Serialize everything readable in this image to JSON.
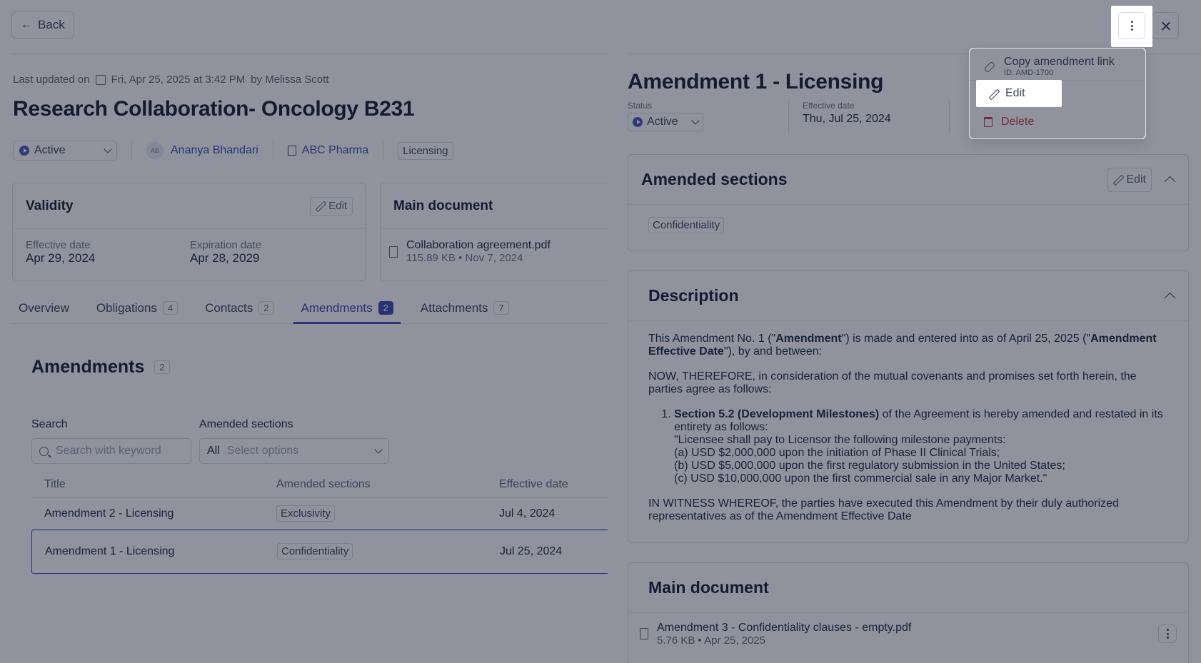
{
  "page": {
    "back_label": "Back",
    "updated_prefix": "Last updated on",
    "updated_date": "Fri, Apr 25, 2025 at 3:42 PM",
    "updated_by": "by Melissa Scott",
    "title": "Research Collaboration- Oncology B231",
    "status": "Active",
    "owner_initials": "AB",
    "owner_name": "Ananya Bhandari",
    "company": "ABC Pharma",
    "category_tag": "Licensing",
    "validity": {
      "title": "Validity",
      "edit_label": "Edit",
      "effective_label": "Effective date",
      "effective_value": "Apr 29, 2024",
      "expiration_label": "Expiration date",
      "expiration_value": "Apr 28, 2029"
    },
    "main_document": {
      "title": "Main document",
      "file_name": "Collaboration agreement.pdf",
      "file_meta": "115.89 KB • Nov 7, 2024"
    },
    "tabs": [
      {
        "label": "Overview",
        "count": ""
      },
      {
        "label": "Obligations",
        "count": "4"
      },
      {
        "label": "Contacts",
        "count": "2"
      },
      {
        "label": "Amendments",
        "count": "2"
      },
      {
        "label": "Attachments",
        "count": "7"
      }
    ],
    "amendments": {
      "title": "Amendments",
      "count": "2",
      "search_label": "Search",
      "search_placeholder": "Search with keyword",
      "sections_label": "Amended sections",
      "sections_all": "All",
      "sections_placeholder": "Select options",
      "columns": [
        "Title",
        "Amended sections",
        "Effective date"
      ],
      "rows": [
        {
          "title": "Amendment 2 - Licensing",
          "section": "Exclusivity",
          "date": "Jul 4, 2024"
        },
        {
          "title": "Amendment 1 - Licensing",
          "section": "Confidentiality",
          "date": "Jul 25, 2024"
        }
      ]
    }
  },
  "drawer": {
    "title": "Amendment 1 - Licensing",
    "status_label": "Status",
    "status_value": "Active",
    "effective_label": "Effective date",
    "effective_value": "Thu, Jul 25, 2024",
    "amended_sections": {
      "title": "Amended sections",
      "edit_label": "Edit",
      "tag": "Confidentiality"
    },
    "description": {
      "title": "Description",
      "p1_a": "This Amendment No. 1 (\"",
      "p1_b": "Amendment",
      "p1_c": "\") is made and entered into as of April 25, 2025 (\"",
      "p1_d": "Amendment Effective Date",
      "p1_e": "\"), by and between:",
      "p2": "NOW, THEREFORE, in consideration of the mutual covenants and promises set forth herein, the parties agree as follows:",
      "li_bold": "Section 5.2 (Development Milestones)",
      "li_rest": " of the Agreement is hereby amended and restated in its entirety as follows:",
      "li_l1": "\"Licensee shall pay to Licensor the following milestone payments:",
      "li_l2": "(a) USD $2,000,000 upon the initiation of Phase II Clinical Trials;",
      "li_l3": "(b) USD $5,000,000 upon the first regulatory submission in the United States;",
      "li_l4": "(c) USD $10,000,000 upon the first commercial sale in any Major Market.\"",
      "p3": "IN WITNESS WHEREOF, the parties have executed this Amendment by their duly authorized representatives as of the Amendment Effective Date"
    },
    "main_document": {
      "title": "Main document",
      "file_name": "Amendment 3 - Confidentiality clauses - empty.pdf",
      "file_meta": "5.76 KB • Apr 25, 2025"
    }
  },
  "menu": {
    "copy_label": "Copy amendment link",
    "copy_sub": "ID: AMD-1700",
    "edit_label": "Edit",
    "delete_label": "Delete"
  },
  "colors": {
    "accent": "#3b46b0",
    "danger": "#c43c3c"
  }
}
